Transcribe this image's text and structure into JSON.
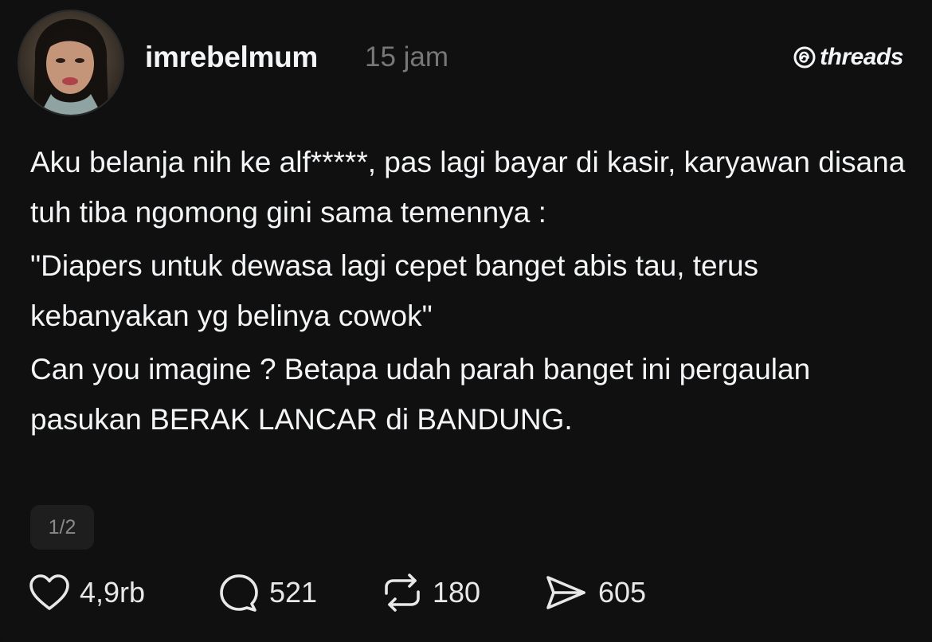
{
  "header": {
    "username": "imrebelmum",
    "time": "15 jam",
    "brand": "threads"
  },
  "post": {
    "paragraphs": [
      "Aku belanja nih ke alf*****, pas lagi bayar di kasir, karyawan disana tuh tiba ngomong gini sama temennya :",
      "\"Diapers untuk dewasa lagi cepet banget abis tau, terus kebanyakan yg belinya cowok\"",
      "Can you imagine ? Betapa udah parah banget ini pergaulan pasukan BERAK LANCAR di BANDUNG."
    ],
    "page_indicator": "1/2"
  },
  "actions": {
    "likes": "4,9rb",
    "replies": "521",
    "reposts": "180",
    "shares": "605"
  },
  "icons": {
    "like": "heart-icon",
    "reply": "comment-icon",
    "repost": "repost-icon",
    "share": "send-icon",
    "brand": "threads-logo-icon"
  },
  "colors": {
    "background": "#101010",
    "text": "#f3f5f7",
    "muted": "#777777",
    "pill": "#1e1e1e"
  }
}
